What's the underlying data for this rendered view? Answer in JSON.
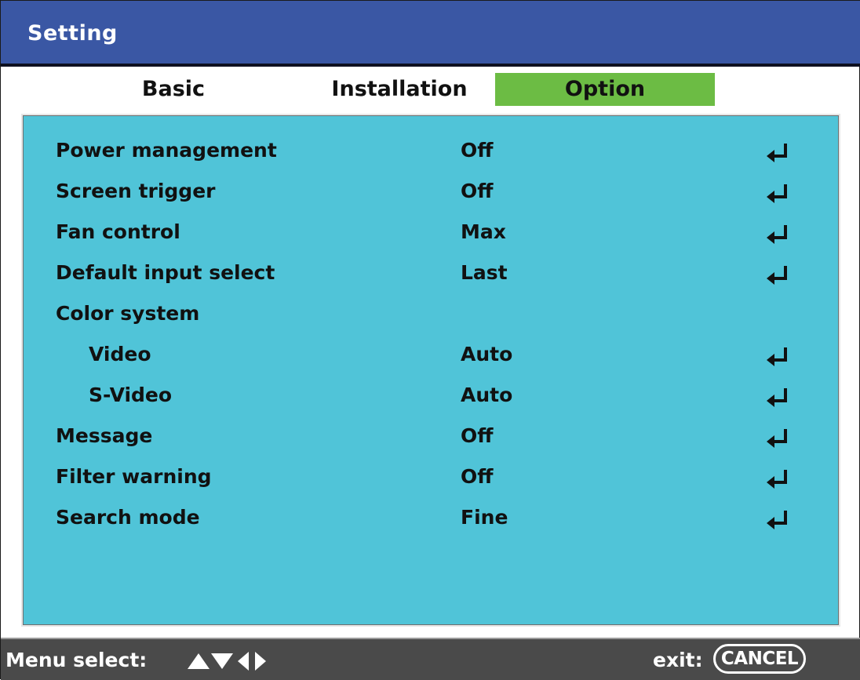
{
  "window": {
    "title": "Setting"
  },
  "tabs": [
    {
      "label": "Basic",
      "selected": false
    },
    {
      "label": "Installation",
      "selected": false
    },
    {
      "label": "Option",
      "selected": true
    }
  ],
  "colors": {
    "titlebar": "#3a57a4",
    "panel": "#50c4d8",
    "selected_tab": "#6cbc44",
    "statusbar": "#4a4a4a"
  },
  "settings": [
    {
      "label": "Power management",
      "value": "Off",
      "icon": "enter-icon"
    },
    {
      "label": "Screen trigger",
      "value": "Off",
      "icon": "enter-icon"
    },
    {
      "label": "Fan control",
      "value": "Max",
      "icon": "enter-icon"
    },
    {
      "label": "Default input select",
      "value": "Last",
      "icon": "enter-icon"
    },
    {
      "label": "Color system",
      "value": "",
      "icon": ""
    },
    {
      "label": "Video",
      "value": "Auto",
      "icon": "enter-icon"
    },
    {
      "label": "S-Video",
      "value": "Auto",
      "icon": "enter-icon"
    },
    {
      "label": "Message",
      "value": "Off",
      "icon": "enter-icon"
    },
    {
      "label": "Filter warning",
      "value": "Off",
      "icon": "enter-icon"
    },
    {
      "label": "Search mode",
      "value": "Fine",
      "icon": "enter-icon"
    }
  ],
  "statusbar": {
    "menu_select_label": "Menu select:",
    "arrow_icons": [
      "up-triangle-icon",
      "down-triangle-icon",
      "left-triangle-icon",
      "right-triangle-icon"
    ],
    "exit_label": "exit:",
    "cancel_label": "CANCEL"
  }
}
